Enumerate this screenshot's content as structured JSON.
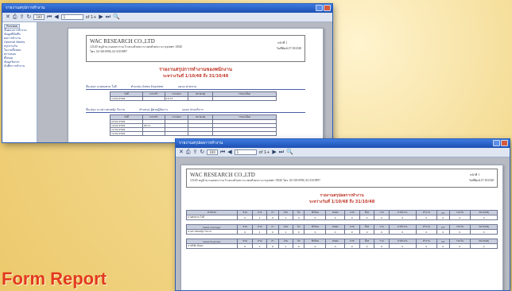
{
  "caption": "Form Report",
  "window1": {
    "title": "รายงานสรุปการทำงาน",
    "toolbar": {
      "zoom": "100",
      "page": "1",
      "page_of": "of 1+"
    },
    "sidebar": {
      "tab": "Preview",
      "items": [
        "ขั้นตอนการทำงาน",
        "ข้อมูลที่บันทึก",
        "ผลการทำงาน",
        "General Works",
        "สรุปรายวัน",
        "ใบงานทั้งหมด",
        "ตรวจสอบ",
        "ทั้งหมด",
        "ข้อมูลวิศวกร",
        "บันทึกการทำงาน"
      ]
    },
    "report": {
      "company": "WAC RESEARCH CO.,LTD",
      "address": "123/45 หมู่บ้าน ถนนพระราม 9 แขวงห้วยขวาง เขตห้วยขวาง กรุงเทพฯ 10320",
      "phone": "โทร. 02-318-0996, 02-318-0997",
      "page_label": "หน้าที่ 1",
      "date_label": "วันที่พิมพ์ 27/10/2548",
      "title": "รายงานสรุปการทำงานของพนักงาน",
      "subtitle": "ระหว่างวันที่ 1/10/48 ถึง 31/10/48",
      "section1": {
        "name": "ชื่อ-สกุล นายสมชาย ใจดี",
        "position": "ตำแหน่ง Sales Engineer",
        "dept": "แผนก ฝ่ายขาย"
      },
      "section2": {
        "name": "ชื่อ-สกุล นางสาวสมหญิง รักงาน",
        "position": "ตำแหน่ง ผู้ช่วยผู้จัดการ",
        "dept": "แผนก ฝ่ายบริการ"
      },
      "headers": [
        "วันที่",
        "เวลาเข้า",
        "เวลาออก",
        "หมายเหตุ",
        "รายละเอียด"
      ],
      "rows1": [
        [
          "14/01/2548",
          "",
          "16:37",
          "",
          ""
        ]
      ],
      "rows2": [
        [
          "03/01/2548",
          "",
          "",
          "",
          ""
        ],
        [
          "10/01/2548",
          "08:11",
          "",
          "",
          ""
        ],
        [
          "11/01/2548",
          "",
          "",
          "",
          ""
        ],
        [
          "12/01/2548",
          "",
          "",
          "",
          ""
        ]
      ]
    }
  },
  "window2": {
    "title": "รายงานสรุปผลการทำงาน",
    "toolbar": {
      "zoom": "100",
      "page": "1",
      "page_of": "of 1+"
    },
    "tooltip": "Export Report",
    "report": {
      "company": "WAC RESEARCH CO.,LTD",
      "address": "123/45 หมู่บ้าน ถนนพระราม 9 แขวงห้วยขวาง เขตห้วยขวาง กรุงเทพฯ 10320 โทร. 02-318-0996, 02-318-0997",
      "page_label": "หน้าที่ 1",
      "date_label": "วันที่พิมพ์ 27/10/2548",
      "title": "รายงานสรุปผลการทำงาน",
      "subtitle": "ระหว่างวันที่ 1/10/48 ถึง 31/10/48",
      "groups": [
        {
          "label": "ฝ่ายขาย",
          "row": "นายสมชาย ใจดี"
        },
        {
          "label": "Sales manager",
          "row": "นางสาวสมหญิง รักงาน"
        },
        {
          "label": "Sales Engineer",
          "row": "นายวิชัย มั่นคง"
        }
      ],
      "headers": [
        "ชื่อพนักงาน",
        "ขาด",
        "สาย",
        "ลา",
        "ป่วย",
        "กิจ",
        "พักร้อน",
        "คลอด",
        "บวช",
        "อื่นๆ",
        "รวม",
        "มาทำงาน",
        "ทำงาน",
        "OT",
        "รวมวัน",
        "หมายเหตุ"
      ],
      "values": [
        "0",
        "1",
        "0",
        "1",
        "0",
        "0",
        "0",
        "0",
        "0",
        "0",
        "0",
        "0",
        "0",
        "0",
        "0"
      ]
    }
  }
}
